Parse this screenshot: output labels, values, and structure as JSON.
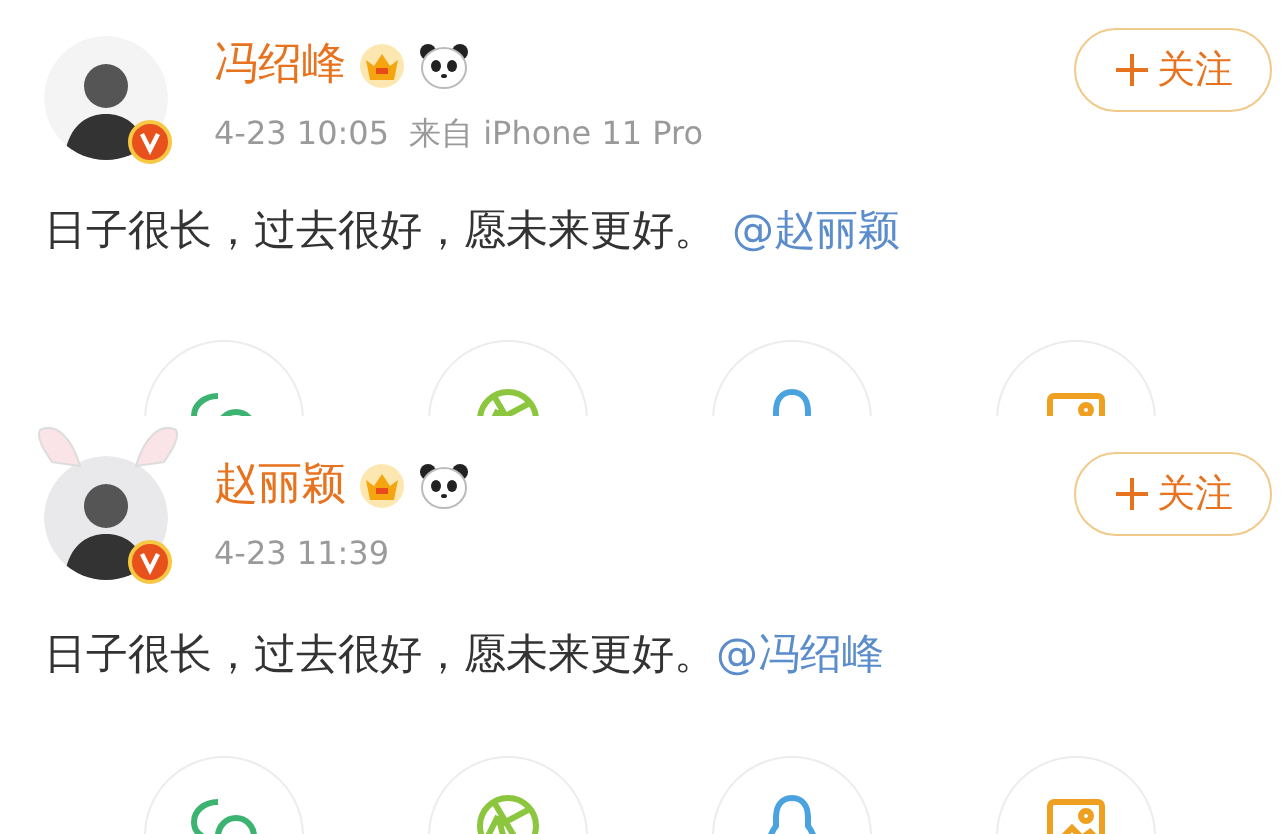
{
  "posts": [
    {
      "author": "冯绍峰",
      "ears": false,
      "verified": true,
      "time": "4-23 10:05",
      "source": "来自 iPhone 11 Pro",
      "text": "日子很长，过去很好，愿未来更好。",
      "mention": "@赵丽颖",
      "follow": "关注",
      "share_buttons": [
        {
          "kind": "wechat"
        },
        {
          "kind": "moments"
        },
        {
          "kind": "qq"
        },
        {
          "kind": "album"
        }
      ]
    },
    {
      "author": "赵丽颖",
      "ears": true,
      "verified": true,
      "time": "4-23 11:39",
      "text": "日子很长，过去很好，愿未来更好。",
      "mention": "@冯绍峰",
      "follow": "关注",
      "share_buttons": [
        {
          "kind": "wechat"
        },
        {
          "kind": "moments"
        },
        {
          "kind": "qq"
        },
        {
          "kind": "album"
        }
      ]
    }
  ]
}
